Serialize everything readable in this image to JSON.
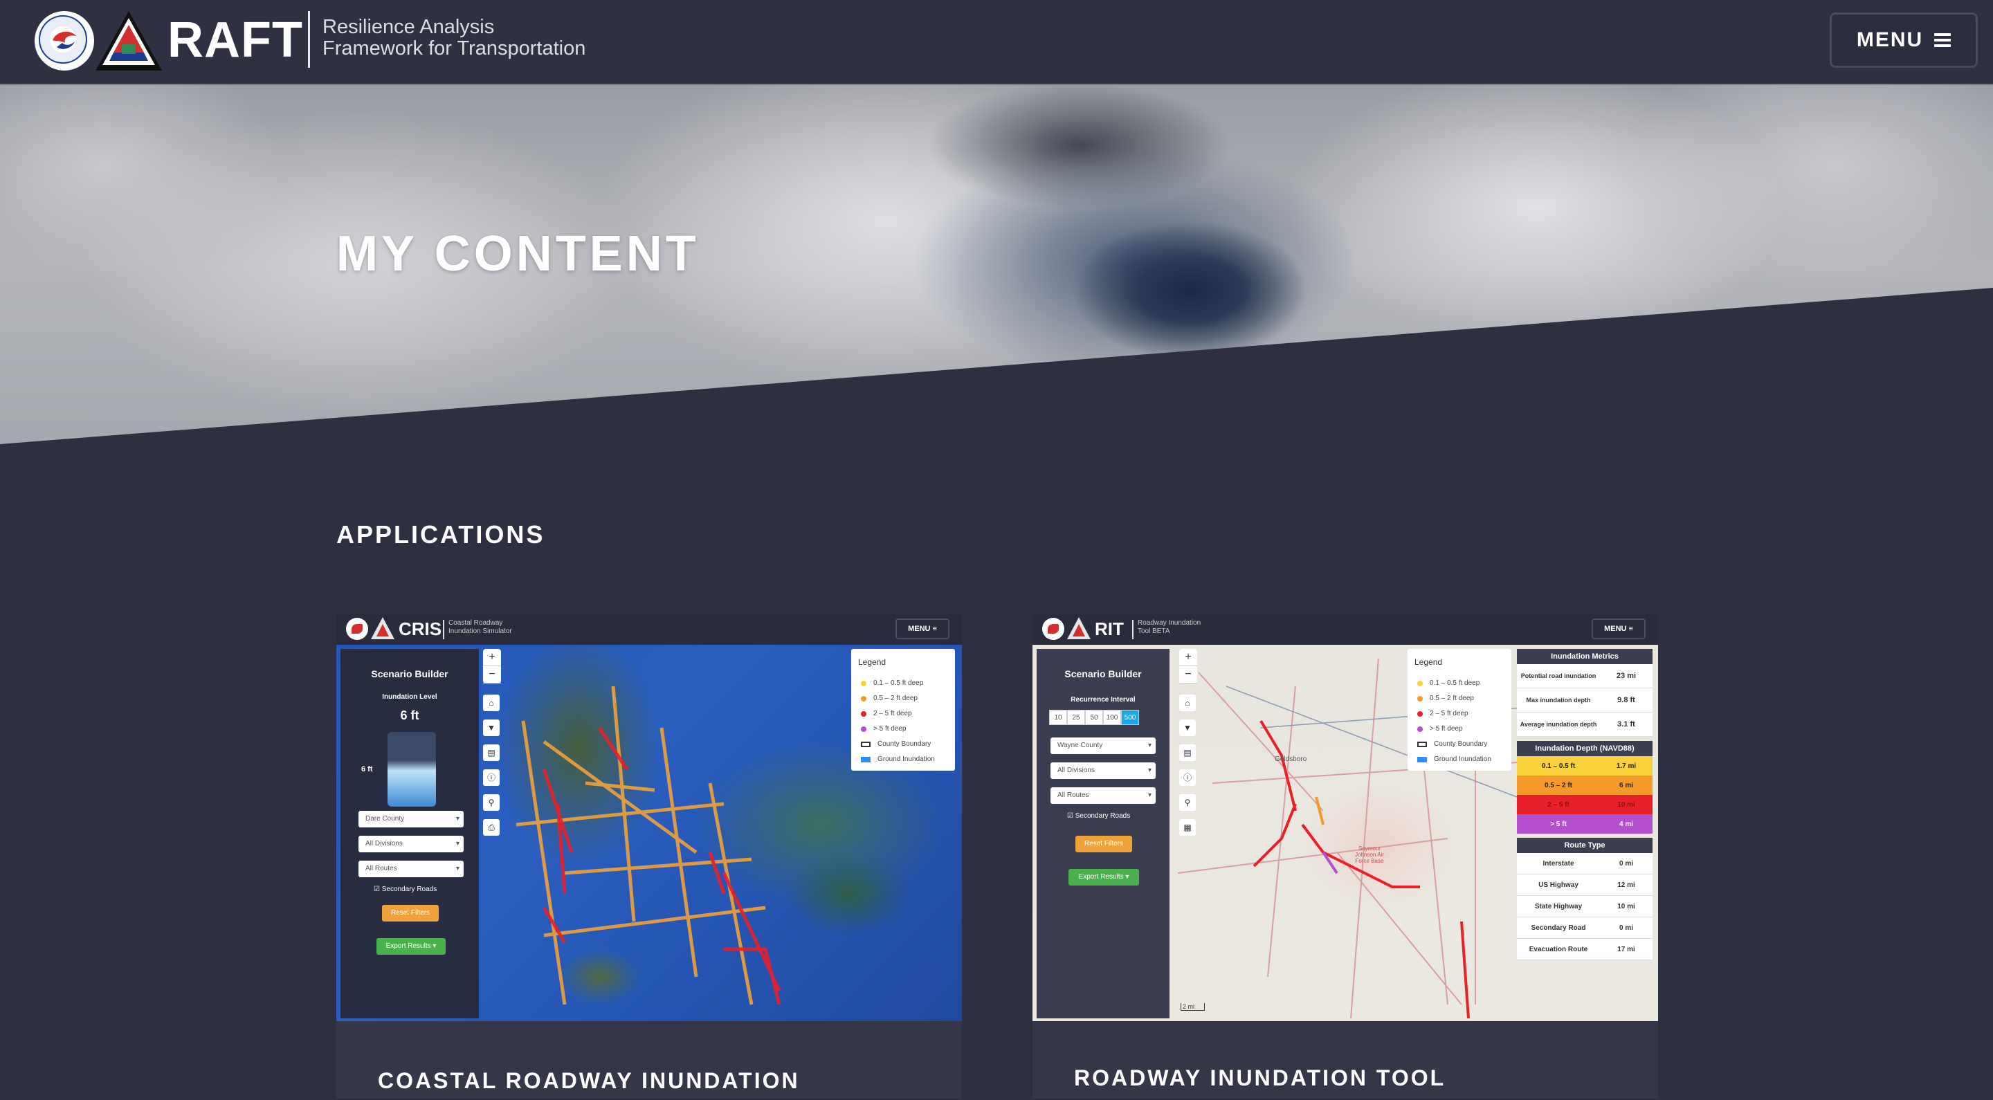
{
  "header": {
    "brand": "RAFT",
    "subtitle_line1": "Resilience Analysis",
    "subtitle_line2": "Framework for Transportation",
    "menu_label": "MENU"
  },
  "hero": {
    "title": "MY CONTENT"
  },
  "applications": {
    "heading": "APPLICATIONS",
    "cards": [
      {
        "title": "COASTAL ROADWAY INUNDATION",
        "app_brand": "CRIS",
        "app_sub_line1": "Coastal Roadway",
        "app_sub_line2": "Inundation Simulator",
        "menu_label": "MENU",
        "panel": {
          "title": "Scenario Builder",
          "level_label": "Inundation Level",
          "level_value": "6 ft",
          "gauge_label": "6 ft",
          "county": "Dare County",
          "divisions": "All Divisions",
          "routes": "All Routes",
          "secondary": "Secondary Roads",
          "reset": "Reset Filters",
          "export": "Export Results ▾"
        },
        "legend": {
          "title": "Legend",
          "items": [
            "0.1 – 0.5 ft deep",
            "0.5 – 2 ft deep",
            "2 – 5 ft deep",
            "> 5 ft deep",
            "County Boundary",
            "Ground Inundation"
          ]
        }
      },
      {
        "title": "ROADWAY INUNDATION TOOL",
        "app_brand": "RIT",
        "app_sub_line1": "Roadway Inundation",
        "app_sub_line2": "Tool BETA",
        "menu_label": "MENU",
        "panel": {
          "title": "Scenario Builder",
          "interval_label": "Recurrence Interval",
          "intervals": [
            "10",
            "25",
            "50",
            "100",
            "500"
          ],
          "county": "Wayne County",
          "divisions": "All Divisions",
          "routes": "All Routes",
          "secondary": "Secondary Roads",
          "reset": "Reset Filters",
          "export": "Export Results ▾"
        },
        "legend": {
          "title": "Legend",
          "items": [
            "0.1 – 0.5 ft deep",
            "0.5 – 2 ft deep",
            "2 – 5 ft deep",
            "> 5 ft deep",
            "County Boundary",
            "Ground Inundation"
          ]
        },
        "metrics": {
          "title": "Inundation Metrics",
          "rows": [
            {
              "k": "Potential road inundation",
              "v": "23 mi"
            },
            {
              "k": "Max inundation depth",
              "v": "9.8 ft"
            },
            {
              "k": "Average inundation depth",
              "v": "3.1 ft"
            }
          ],
          "depth_title": "Inundation Depth (NAVD88)",
          "depth_rows": [
            {
              "k": "0.1 – 0.5 ft",
              "v": "1.7 mi"
            },
            {
              "k": "0.5 – 2 ft",
              "v": "6 mi"
            },
            {
              "k": "2 – 5 ft",
              "v": "10 mi"
            },
            {
              "k": "> 5 ft",
              "v": "4 mi"
            }
          ],
          "route_title": "Route Type",
          "route_rows": [
            {
              "k": "Interstate",
              "v": "0 mi"
            },
            {
              "k": "US Highway",
              "v": "12 mi"
            },
            {
              "k": "State Highway",
              "v": "10 mi"
            },
            {
              "k": "Secondary Road",
              "v": "0 mi"
            },
            {
              "k": "Evacuation Route",
              "v": "17 mi"
            }
          ]
        },
        "map_labels": {
          "city": "Goldsboro",
          "afb": "Seymour Johnson Air Force Base",
          "scale": "2 mi"
        }
      }
    ]
  },
  "colors": {
    "page_bg": "#2e2f40",
    "card_bg": "#353648",
    "depth_1": "#f7d23a",
    "depth_2": "#f39a2a",
    "depth_3": "#e8202a",
    "depth_4": "#b44fd1",
    "ground": "#2e8ff0",
    "button_orange": "#f0a23a",
    "button_green": "#4bb14e"
  }
}
